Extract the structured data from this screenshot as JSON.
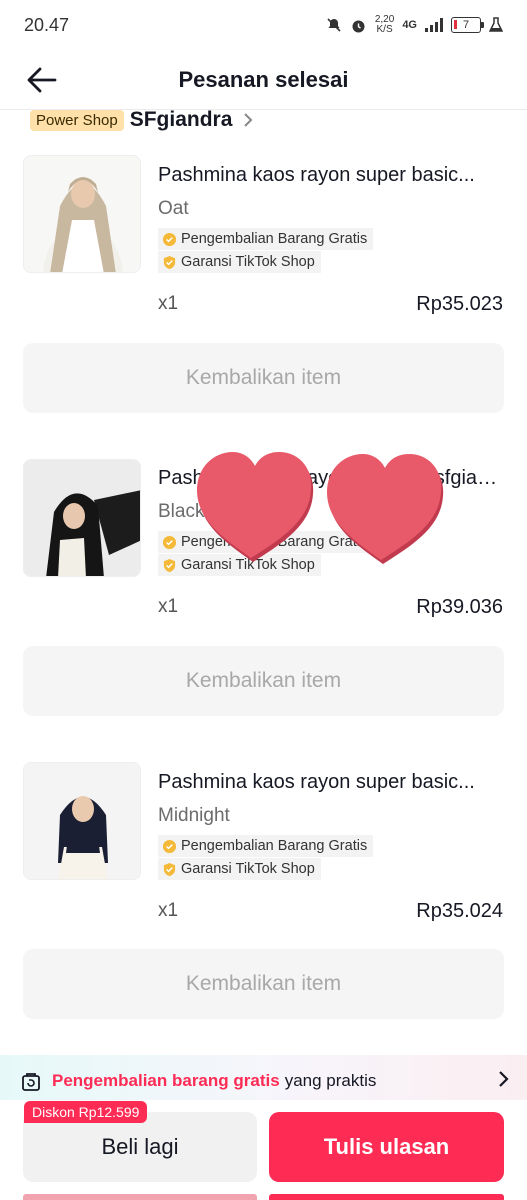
{
  "status_bar": {
    "time": "20.47",
    "net_speed_value": "2,20",
    "net_speed_unit": "K/S",
    "network": "4G",
    "battery": "7"
  },
  "header": {
    "title": "Pesanan selesai",
    "back_icon": "arrow-left-icon"
  },
  "shop": {
    "badge": "Power Shop",
    "name": "SFgiandra",
    "chevron_icon": "chevron-right-icon"
  },
  "products": [
    {
      "title": "Pashmina kaos rayon super basic...",
      "variant": "Oat",
      "tags": [
        "Pengembalian Barang Gratis",
        "Garansi TikTok Shop"
      ],
      "qty": "x1",
      "price": "Rp35.023",
      "return_label": "Kembalikan item"
    },
    {
      "title": "Pashmina kaos rayon basic by sfgiandra",
      "variant": "Black",
      "tags": [
        "Pengembalian Barang Gratis",
        "Garansi TikTok Shop"
      ],
      "qty": "x1",
      "price": "Rp39.036",
      "return_label": "Kembalikan item"
    },
    {
      "title": "Pashmina kaos rayon super basic...",
      "variant": "Midnight",
      "tags": [
        "Pengembalian Barang Gratis",
        "Garansi TikTok Shop"
      ],
      "qty": "x1",
      "price": "Rp35.024",
      "return_label": "Kembalikan item"
    }
  ],
  "promo": {
    "highlight": "Pengembalian barang gratis",
    "rest": "yang praktis"
  },
  "actions": {
    "discount_badge": "Diskon Rp12.599",
    "buy_again": "Beli lagi",
    "write_review": "Tulis ulasan"
  },
  "colors": {
    "accent": "#fe2c55",
    "badge_bg": "#ffe0a8",
    "heart": "#e85a6a"
  }
}
